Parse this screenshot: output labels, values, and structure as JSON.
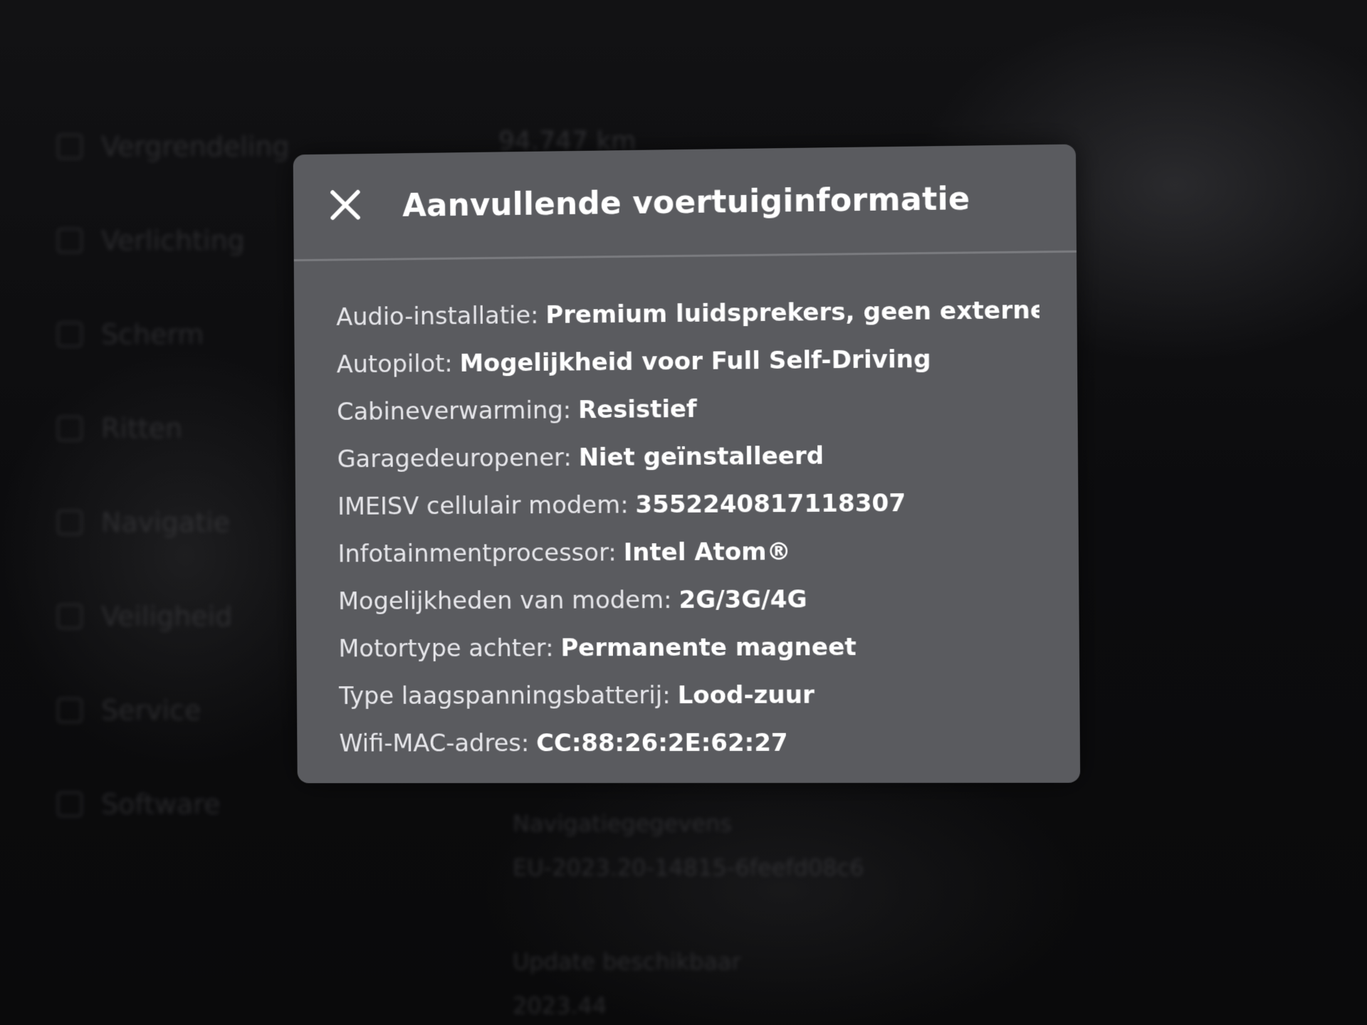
{
  "background": {
    "menu_items": [
      {
        "label": "Vergrendeling",
        "icon": "lock-icon"
      },
      {
        "label": "Verlichting",
        "icon": "light-icon"
      },
      {
        "label": "Scherm",
        "icon": "display-icon"
      },
      {
        "label": "Ritten",
        "icon": "trip-icon"
      },
      {
        "label": "Navigatie",
        "icon": "navigation-icon"
      },
      {
        "label": "Veiligheid",
        "icon": "safety-icon"
      },
      {
        "label": "Service",
        "icon": "wrench-icon"
      },
      {
        "label": "Software",
        "icon": "download-icon"
      }
    ],
    "odometer": "94.747 km",
    "nav_data_label": "Navigatiegegevens",
    "nav_data_value": "EU-2023.20-14815-6feefd08c6",
    "update_label": "Update beschikbaar",
    "update_value": "2023.44"
  },
  "modal": {
    "title": "Aanvullende voertuiginformatie",
    "close_icon": "close-icon",
    "items": [
      {
        "label": "Audio-installatie:",
        "value": "Premium luidsprekers, geen externe ver"
      },
      {
        "label": "Autopilot:",
        "value": "Mogelijkheid voor Full Self-Driving"
      },
      {
        "label": "Cabineverwarming:",
        "value": "Resistief"
      },
      {
        "label": "Garagedeuropener:",
        "value": "Niet geïnstalleerd"
      },
      {
        "label": "IMEISV cellulair modem:",
        "value": "3552240817118307"
      },
      {
        "label": "Infotainmentprocessor:",
        "value": "Intel Atom®"
      },
      {
        "label": "Mogelijkheden van modem:",
        "value": "2G/3G/4G"
      },
      {
        "label": "Motortype achter:",
        "value": "Permanente magneet"
      },
      {
        "label": "Type laagspanningsbatterij:",
        "value": "Lood-zuur"
      },
      {
        "label": "Wifi-MAC-adres:",
        "value": "CC:88:26:2E:62:27"
      }
    ]
  },
  "colors": {
    "modal_background": "#5a5b5f",
    "screen_background": "#0b0b0d",
    "text": "#ffffff"
  }
}
